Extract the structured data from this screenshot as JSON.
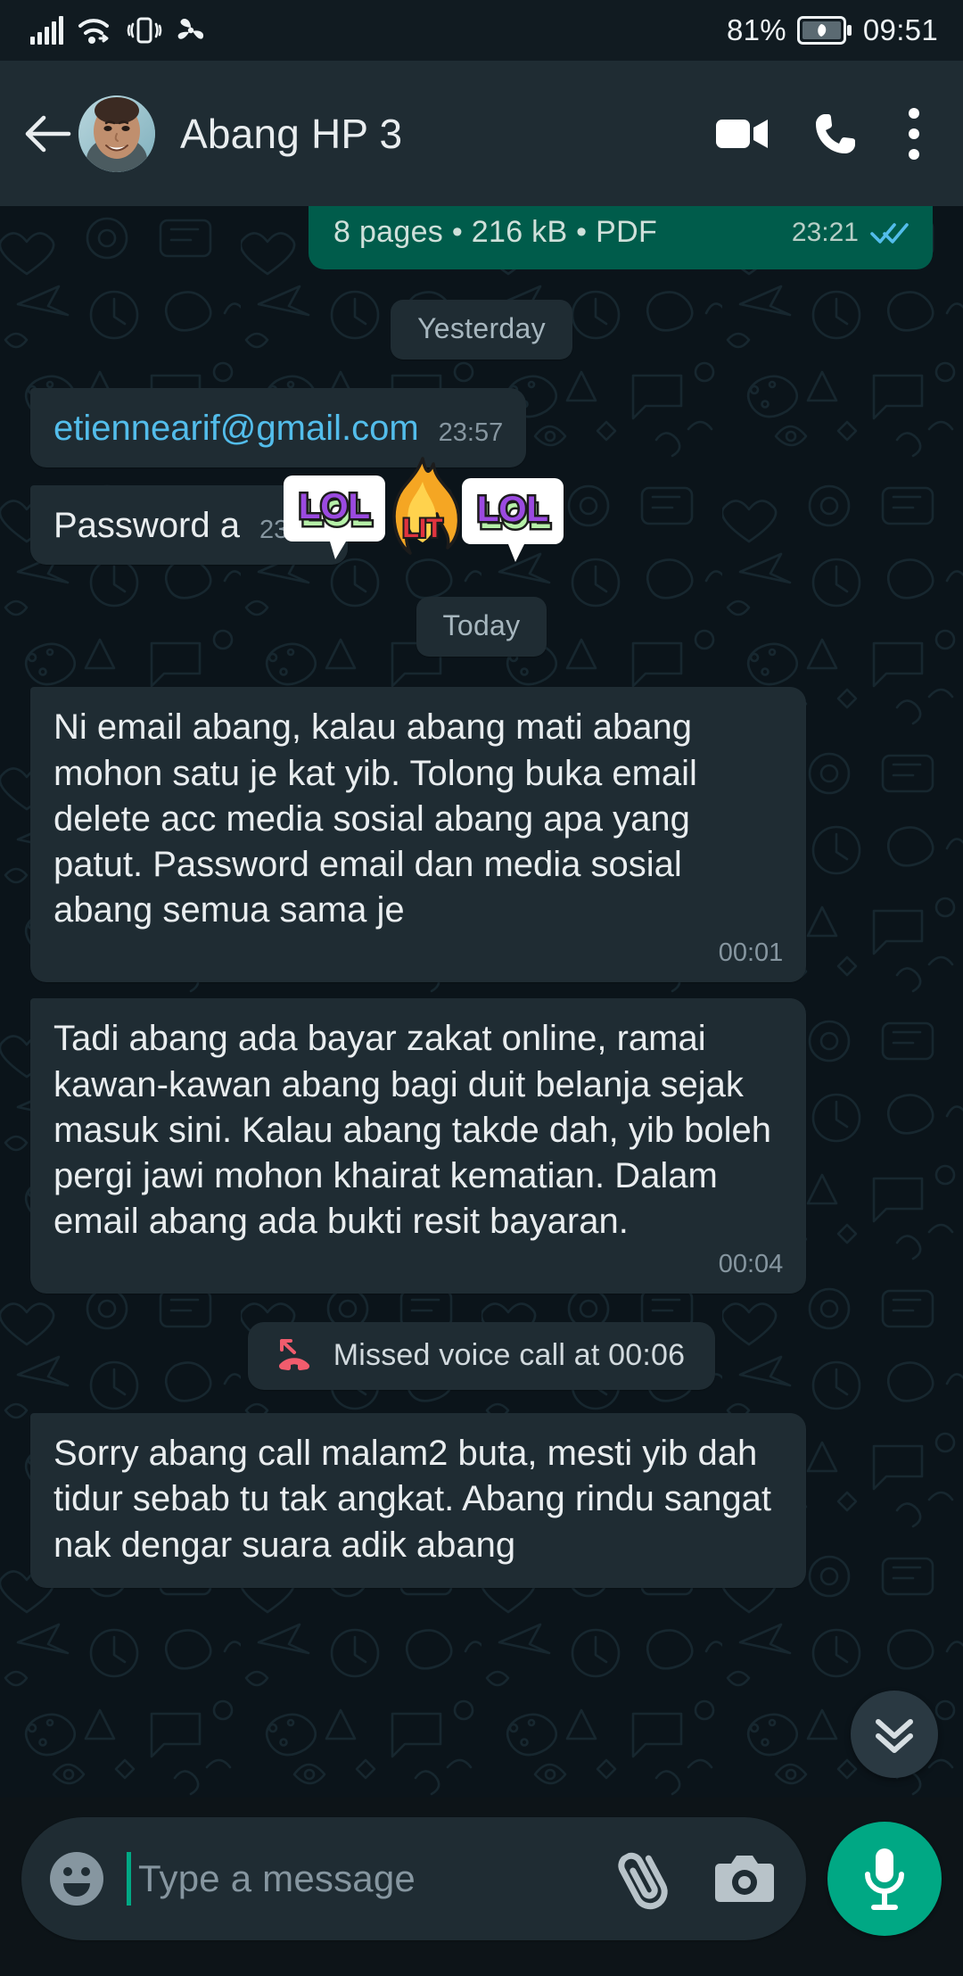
{
  "status_bar": {
    "battery_percent": "81%",
    "clock": "09:51",
    "icons": [
      "signal-bars-icon",
      "wifi-icon",
      "vibrate-mode-icon",
      "fan-icon",
      "battery-saver-icon"
    ]
  },
  "header": {
    "title": "Abang HP 3",
    "back_icon": "back-arrow-icon",
    "avatar": "contact-avatar",
    "video_call_icon": "video-call-icon",
    "voice_call_icon": "phone-call-icon",
    "overflow_icon": "more-options-icon"
  },
  "messages": [
    {
      "kind": "document",
      "direction": "outgoing",
      "info": "8 pages • 216 kB • PDF",
      "time": "23:21",
      "status": "read"
    },
    {
      "kind": "divider",
      "label": "Yesterday"
    },
    {
      "kind": "text",
      "direction": "incoming",
      "text": "etiennearif@gmail.com",
      "is_link": true,
      "time": "23:57"
    },
    {
      "kind": "text",
      "direction": "incoming",
      "text": "Password a",
      "is_link": false,
      "time": "23:58",
      "stickers": [
        "lol-sticker",
        "lit-fire-sticker",
        "lol-sticker"
      ]
    },
    {
      "kind": "divider",
      "label": "Today"
    },
    {
      "kind": "text",
      "direction": "incoming",
      "text": "Ni email abang, kalau abang mati abang mohon satu je kat yib. Tolong buka email delete acc media sosial abang apa yang patut. Password email dan media sosial abang semua sama je",
      "is_link": false,
      "time": "00:01"
    },
    {
      "kind": "text",
      "direction": "incoming",
      "text": "Tadi abang ada bayar zakat online, ramai kawan-kawan abang bagi duit belanja sejak masuk sini. Kalau abang takde dah, yib boleh pergi jawi mohon khairat kematian. Dalam email abang ada bukti resit bayaran.",
      "is_link": false,
      "time": "00:04"
    },
    {
      "kind": "system",
      "label": "Missed voice call at 00:06",
      "icon": "missed-call-icon"
    },
    {
      "kind": "text",
      "direction": "incoming",
      "text": "Sorry abang call malam2 buta, mesti yib dah tidur sebab tu tak angkat. Abang rindu sangat nak dengar suara adik abang",
      "is_link": false,
      "time": ""
    }
  ],
  "scroll_fab": {
    "icon": "double-chevron-down-icon"
  },
  "composer": {
    "placeholder": "Type a message",
    "value": "",
    "emoji_icon": "emoji-smiley-icon",
    "attach_icon": "paperclip-attach-icon",
    "camera_icon": "camera-icon",
    "mic_icon": "microphone-icon"
  },
  "colors": {
    "accent": "#00a884",
    "outgoing_bubble": "#005c4b",
    "incoming_bubble": "#1f2c33",
    "header": "#1f2c33",
    "wallpaper": "#0b141a",
    "link": "#53bdeb",
    "missed_call": "#f15c6d"
  }
}
